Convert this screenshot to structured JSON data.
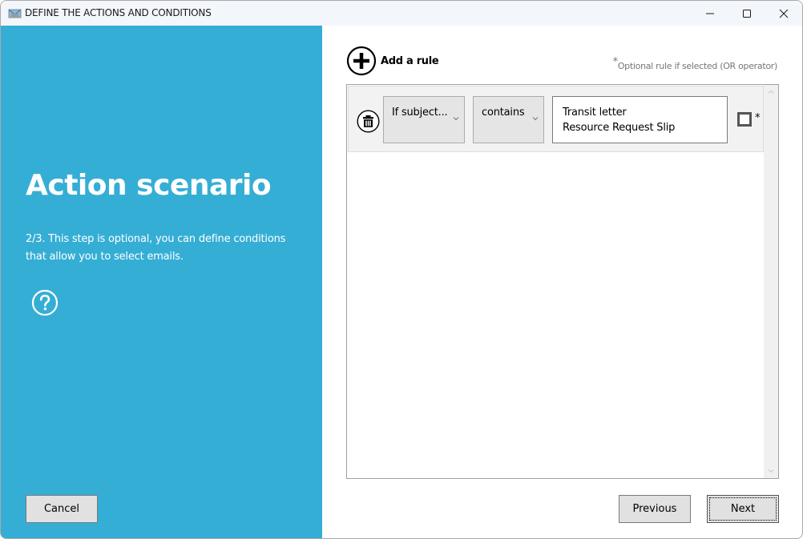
{
  "window": {
    "title": "DEFINE THE ACTIONS AND CONDITIONS",
    "app_icon": "mail-envelope-icon",
    "controls": {
      "minimize": "minimize-icon",
      "maximize": "maximize-icon",
      "close": "close-icon"
    }
  },
  "left_panel": {
    "background_color": "#35aed5",
    "title": "Action scenario",
    "description": "2/3. This step is optional, you can define conditions that allow you to select emails.",
    "help_icon": "question-circle-icon",
    "cancel_label": "Cancel"
  },
  "rules": {
    "add_rule_label": "Add a rule",
    "add_rule_icon": "plus-circle-icon",
    "optional_note_star": "*",
    "optional_note": "Optional rule if selected (OR operator)",
    "items": [
      {
        "delete_icon": "trash-icon",
        "field": "If subject...",
        "operator": "contains",
        "values": [
          "Transit letter",
          "Resource Request Slip"
        ],
        "optional_checked": false,
        "optional_marker": "*"
      }
    ]
  },
  "navigation": {
    "previous_label": "Previous",
    "next_label": "Next"
  }
}
